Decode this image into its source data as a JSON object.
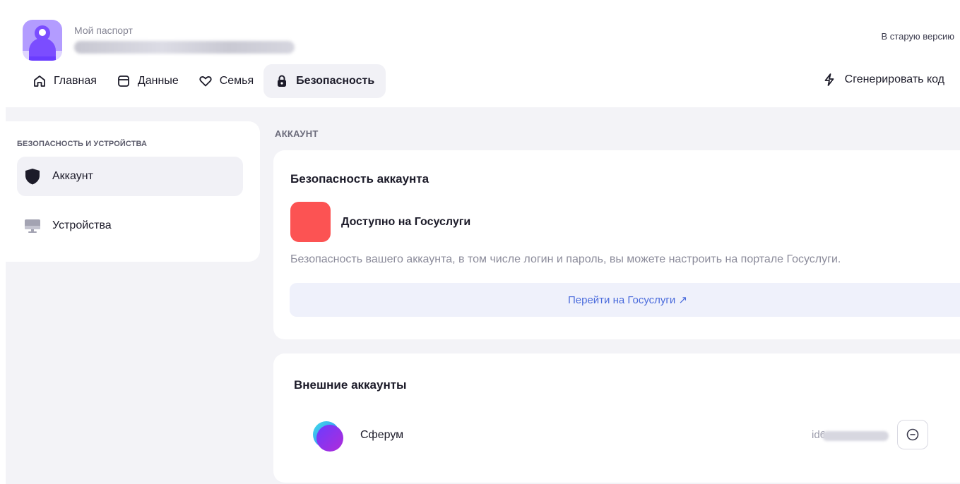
{
  "header": {
    "brand_title": "Мой паспорт",
    "old_version_link": "В старую версию",
    "generate_code": "Сгенерировать код"
  },
  "nav": {
    "items": [
      {
        "label": "Главная",
        "icon": "home-icon",
        "active": false
      },
      {
        "label": "Данные",
        "icon": "folder-icon",
        "active": false
      },
      {
        "label": "Семья",
        "icon": "heart-icon",
        "active": false
      },
      {
        "label": "Безопасность",
        "icon": "lock-icon",
        "active": true
      }
    ]
  },
  "sidebar": {
    "title": "БЕЗОПАСНОСТЬ И УСТРОЙСТВА",
    "items": [
      {
        "label": "Аккаунт",
        "icon": "shield-icon",
        "active": true
      },
      {
        "label": "Устройства",
        "icon": "monitor-icon",
        "active": false
      }
    ]
  },
  "main": {
    "section_label": "АККАУНТ",
    "security_card": {
      "title": "Безопасность аккаунта",
      "gosuslugi_title": "Доступно на Госуслуги",
      "description": "Безопасность вашего аккаунта, в том числе логин и пароль, вы можете настроить на портале Госуслуги.",
      "button_label": "Перейти на Госуслуги ↗"
    },
    "external_card": {
      "title": "Внешние аккаунты",
      "accounts": [
        {
          "name": "Сферум",
          "id_prefix": "id6",
          "icon": "sferum-logo-icon"
        }
      ]
    }
  },
  "colors": {
    "accent_purple": "#7b4dff",
    "gosuslugi_red": "#fc5353",
    "link_blue": "#4a6bdc",
    "background": "#f3f3f7"
  }
}
